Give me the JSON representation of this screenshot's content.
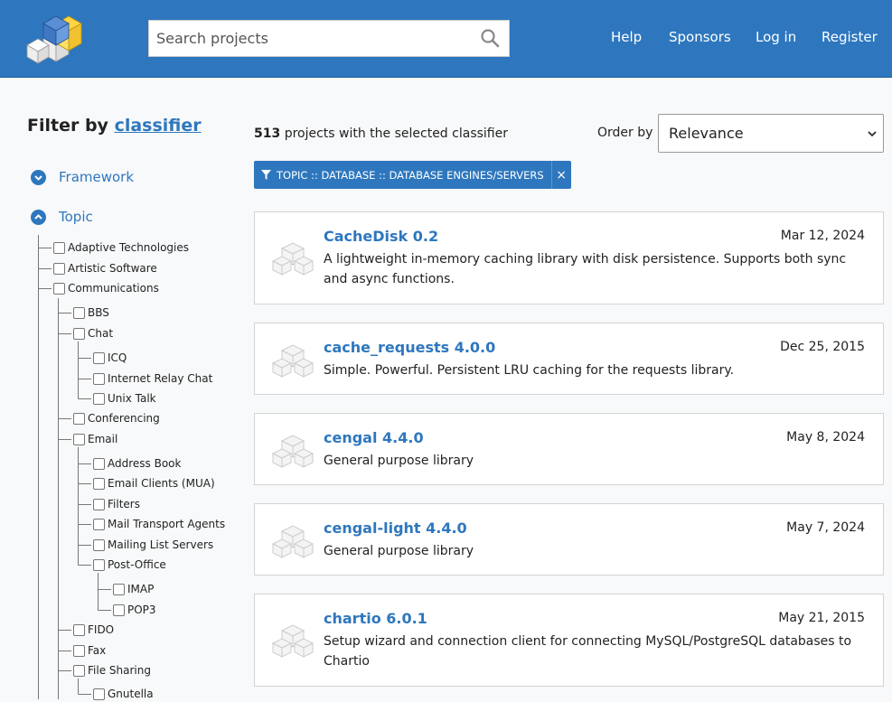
{
  "header": {
    "search_placeholder": "Search projects",
    "nav": [
      "Help",
      "Sponsors",
      "Log in",
      "Register"
    ]
  },
  "sidebar": {
    "title_prefix": "Filter by",
    "title_link": "classifier",
    "categories": [
      "Framework",
      "Topic"
    ],
    "tree": [
      {
        "label": "Adaptive Technologies",
        "level": 0
      },
      {
        "label": "Artistic Software",
        "level": 0
      },
      {
        "label": "Communications",
        "level": 0
      },
      {
        "label": "BBS",
        "level": 1
      },
      {
        "label": "Chat",
        "level": 1
      },
      {
        "label": "ICQ",
        "level": 2
      },
      {
        "label": "Internet Relay Chat",
        "level": 2
      },
      {
        "label": "Unix Talk",
        "level": 2
      },
      {
        "label": "Conferencing",
        "level": 1
      },
      {
        "label": "Email",
        "level": 1
      },
      {
        "label": "Address Book",
        "level": 2
      },
      {
        "label": "Email Clients (MUA)",
        "level": 2
      },
      {
        "label": "Filters",
        "level": 2
      },
      {
        "label": "Mail Transport Agents",
        "level": 2
      },
      {
        "label": "Mailing List Servers",
        "level": 2
      },
      {
        "label": "Post-Office",
        "level": 2
      },
      {
        "label": "IMAP",
        "level": 3
      },
      {
        "label": "POP3",
        "level": 3
      },
      {
        "label": "FIDO",
        "level": 1
      },
      {
        "label": "Fax",
        "level": 1
      },
      {
        "label": "File Sharing",
        "level": 1
      },
      {
        "label": "Gnutella",
        "level": 2
      }
    ]
  },
  "results": {
    "count": "513",
    "count_suffix": "projects with the selected classifier",
    "order_label": "Order by",
    "order_value": "Relevance",
    "active_filter": "TOPIC :: DATABASE :: DATABASE ENGINES/SERVERS",
    "remove_symbol": "×",
    "projects": [
      {
        "name": "CacheDisk 0.2",
        "date": "Mar 12, 2024",
        "desc": "A lightweight in-memory caching library with disk persistence. Supports both sync and async functions."
      },
      {
        "name": "cache_requests 4.0.0",
        "date": "Dec 25, 2015",
        "desc": "Simple. Powerful. Persistent LRU caching for the requests library."
      },
      {
        "name": "cengal 4.4.0",
        "date": "May 8, 2024",
        "desc": "General purpose library"
      },
      {
        "name": "cengal-light 4.4.0",
        "date": "May 7, 2024",
        "desc": "General purpose library"
      },
      {
        "name": "chartio 6.0.1",
        "date": "May 21, 2015",
        "desc": "Setup wizard and connection client for connecting MySQL/PostgreSQL databases to Chartio"
      }
    ]
  },
  "colors": {
    "brand_blue": "#2e77be",
    "page_bg": "#f8f9fa"
  },
  "icons": [
    "pypi-logo",
    "search-icon",
    "chevron-down-icon",
    "chevron-up-icon",
    "filter-icon",
    "close-icon",
    "package-icon"
  ]
}
